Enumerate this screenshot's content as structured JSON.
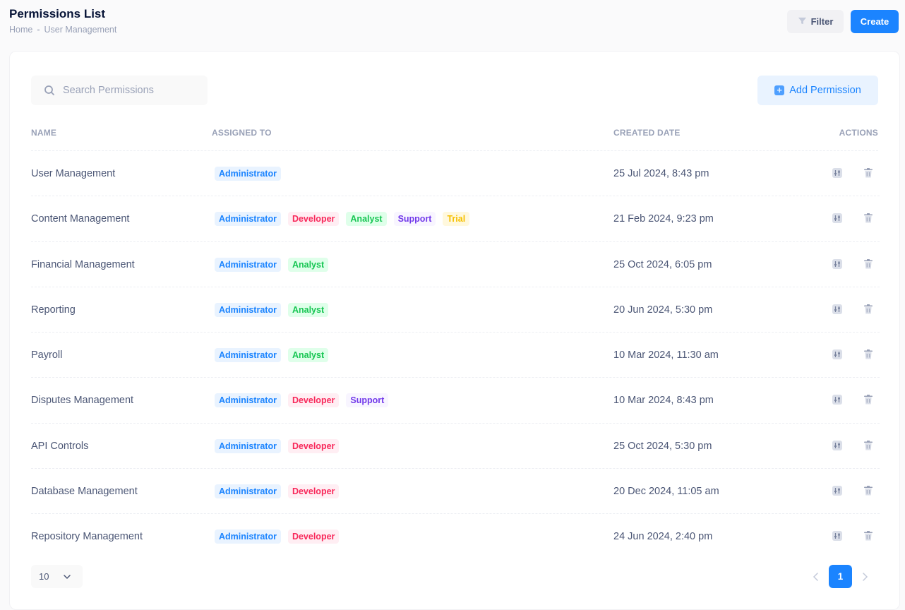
{
  "header": {
    "title": "Permissions List",
    "breadcrumb": [
      "Home",
      "User Management"
    ],
    "breadcrumb_sep": "-",
    "filter_label": "Filter",
    "create_label": "Create"
  },
  "toolbar": {
    "search_placeholder": "Search Permissions",
    "search_value": "",
    "add_label": "Add Permission"
  },
  "table": {
    "columns": [
      "NAME",
      "ASSIGNED TO",
      "CREATED DATE",
      "ACTIONS"
    ],
    "rows": [
      {
        "name": "User Management",
        "assigned": [
          "Administrator"
        ],
        "date": "25 Jul 2024, 8:43 pm"
      },
      {
        "name": "Content Management",
        "assigned": [
          "Administrator",
          "Developer",
          "Analyst",
          "Support",
          "Trial"
        ],
        "date": "21 Feb 2024, 9:23 pm"
      },
      {
        "name": "Financial Management",
        "assigned": [
          "Administrator",
          "Analyst"
        ],
        "date": "25 Oct 2024, 6:05 pm"
      },
      {
        "name": "Reporting",
        "assigned": [
          "Administrator",
          "Analyst"
        ],
        "date": "20 Jun 2024, 5:30 pm"
      },
      {
        "name": "Payroll",
        "assigned": [
          "Administrator",
          "Analyst"
        ],
        "date": "10 Mar 2024, 11:30 am"
      },
      {
        "name": "Disputes Management",
        "assigned": [
          "Administrator",
          "Developer",
          "Support"
        ],
        "date": "10 Mar 2024, 8:43 pm"
      },
      {
        "name": "API Controls",
        "assigned": [
          "Administrator",
          "Developer"
        ],
        "date": "25 Oct 2024, 5:30 pm"
      },
      {
        "name": "Database Management",
        "assigned": [
          "Administrator",
          "Developer"
        ],
        "date": "20 Dec 2024, 11:05 am"
      },
      {
        "name": "Repository Management",
        "assigned": [
          "Administrator",
          "Developer"
        ],
        "date": "24 Jun 2024, 2:40 pm"
      }
    ]
  },
  "footer": {
    "page_size": "10",
    "current_page": "1"
  },
  "colors": {
    "primary": "#1b84ff",
    "administrator": "#1b84ff",
    "developer": "#f8285a",
    "analyst": "#17c653",
    "support": "#7239ea",
    "trial": "#f6c000"
  },
  "icons": {
    "filter": "filter-icon",
    "search": "search-icon",
    "add": "plus-square-icon",
    "edit": "sliders-icon",
    "delete": "trash-icon",
    "chevron": "chevron-down-icon",
    "prev": "chevron-left-icon",
    "next": "chevron-right-icon"
  }
}
